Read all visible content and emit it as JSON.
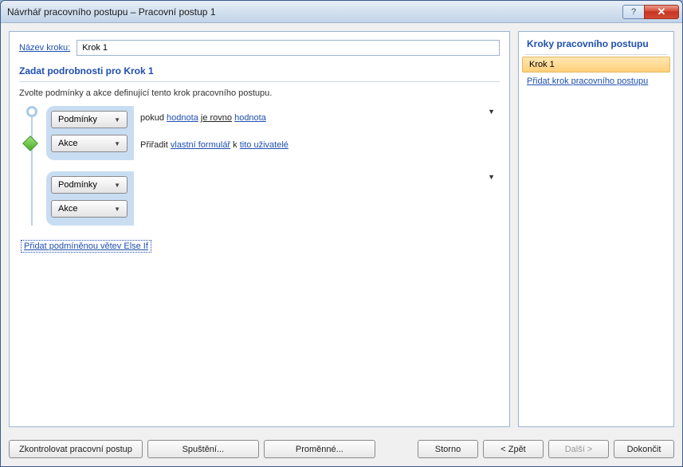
{
  "titlebar": {
    "title": "Návrhář pracovního postupu – Pracovní postup 1"
  },
  "left": {
    "name_label": "Název kroku:",
    "name_value": "Krok 1",
    "section_heading": "Zadat podrobnosti pro Krok 1",
    "instructions": "Zvolte podmínky a akce definující tento krok pracovního postupu.",
    "conditions_btn": "Podmínky",
    "actions_btn": "Akce",
    "cond_prefix": "pokud",
    "cond_val1": "hodnota",
    "cond_op": "je rovno",
    "cond_val2": "hodnota",
    "act_prefix": "Přiřadit",
    "act_link1": "vlastní formulář",
    "act_mid": "k",
    "act_link2": "tito uživatelé",
    "add_else": "Přidat podmíněnou větev Else If"
  },
  "right": {
    "heading": "Kroky pracovního postupu",
    "step1": "Krok 1",
    "add_step": "Přidat krok pracovního postupu"
  },
  "buttons": {
    "check": "Zkontrolovat pracovní postup",
    "run": "Spuštění...",
    "vars": "Proměnné...",
    "cancel": "Storno",
    "back": "< Zpět",
    "next": "Další >",
    "finish": "Dokončit"
  }
}
